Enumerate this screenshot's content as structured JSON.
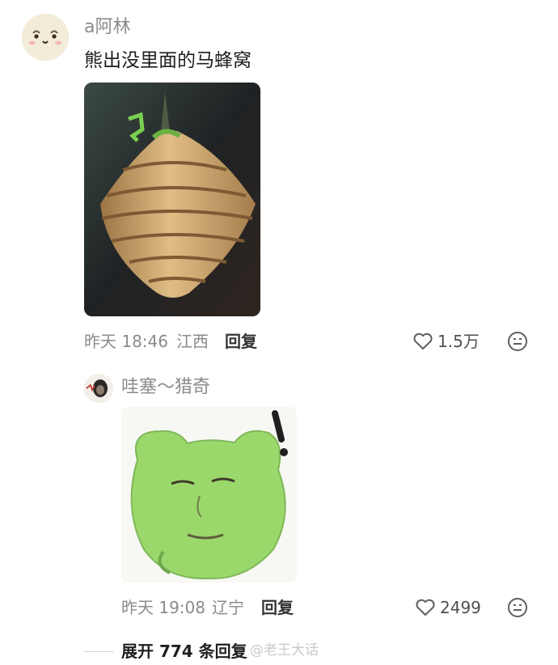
{
  "comment": {
    "username": "a阿林",
    "text": "熊出没里面的马蜂窝",
    "time": "昨天 18:46",
    "location": "江西",
    "reply_label": "回复",
    "like_count": "1.5万"
  },
  "reply": {
    "username": "哇塞～猎奇",
    "time": "昨天 19:08",
    "location": "辽宁",
    "reply_label": "回复",
    "like_count": "2499"
  },
  "expand_label": "展开 774 条回复",
  "watermark": "@老王大话",
  "icons": {
    "like": "heart-icon",
    "emoji": "emoji-icon"
  }
}
